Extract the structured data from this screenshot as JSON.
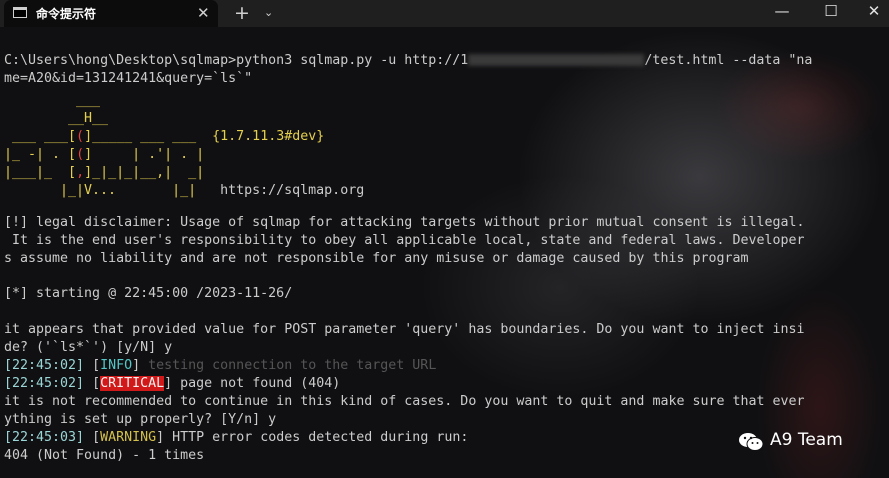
{
  "window": {
    "tab_title": "命令提示符",
    "tab_close": "✕",
    "new_tab": "+",
    "dropdown": "⌄",
    "minimize": "—",
    "maximize": "☐",
    "close": "✕"
  },
  "terminal": {
    "cmd_line1": "C:\\Users\\hong\\Desktop\\sqlmap>python3 sqlmap.py -u http://1",
    "cmd_line1_tail": "/test.html --data \"na",
    "cmd_line2": "me=A20&id=131241241&query=`ls`\"",
    "banner_line1": "___",
    "banner_line2": "__H__",
    "banner_line3a": "___ ___[",
    "banner_line3b": "(",
    "banner_line3c": "]_____ ___ ___  ",
    "version": "{1.7.11.3#dev}",
    "banner_line4a": "|_ -| . [",
    "banner_line4b": "(",
    "banner_line4c": "]     | .'| . |",
    "banner_line5a": "|___|_  [",
    "banner_line5b": ",",
    "banner_line5c": "]_|_|_|__,|  _|",
    "banner_line6": "|_|V...       |_|   ",
    "url": "https://sqlmap.org",
    "disclaimer1": "[!] legal disclaimer: Usage of sqlmap for attacking targets without prior mutual consent is illegal.",
    "disclaimer2": " It is the end user's responsibility to obey all applicable local, state and federal laws. Developer",
    "disclaimer3": "s assume no liability and are not responsible for any misuse or damage caused by this program",
    "starting": "[*] starting @ 22:45:00 /2023-11-26/",
    "prompt1a": "it appears that provided value for POST parameter 'query' has boundaries. Do you want to inject insi",
    "prompt1b": "de? ('`ls*`') [y/N] y",
    "log1_ts": "[22:45:02]",
    "log1_lvl": "INFO",
    "log1_msg": "testing connection to the target URL",
    "log2_ts": "[22:45:02]",
    "log2_lvl": "CRITICAL",
    "log2_msg": " page not found (404)",
    "prompt2a": "it is not recommended to continue in this kind of cases. Do you want to quit and make sure that ever",
    "prompt2b": "ything is set up properly? [Y/n] y",
    "log3_ts": "[22:45:03]",
    "log3_lvl": "WARNING",
    "log3_msg": " HTTP error codes detected during run:",
    "summary": "404 (Not Found) - 1 times"
  },
  "watermark": {
    "text": "A9 Team",
    "icon": "wechat-icon"
  }
}
